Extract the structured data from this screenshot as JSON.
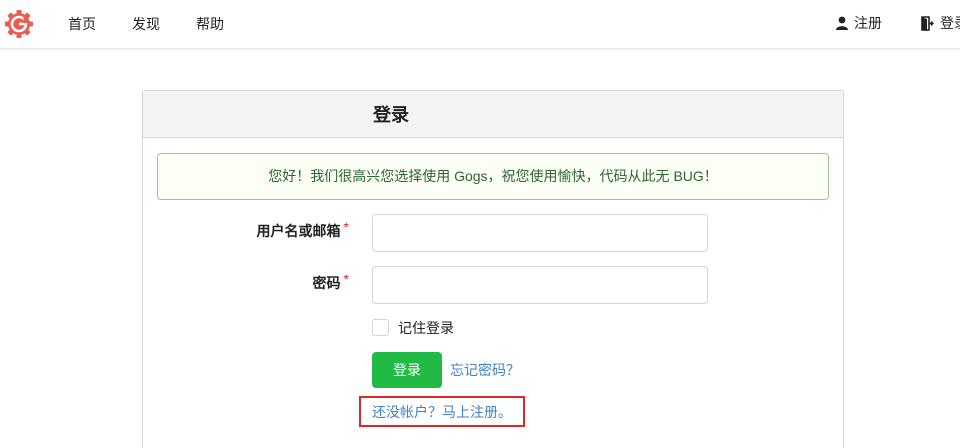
{
  "nav": {
    "items": [
      {
        "label": "首页"
      },
      {
        "label": "发现"
      },
      {
        "label": "帮助"
      }
    ],
    "register_label": "注册",
    "login_label": "登录"
  },
  "login": {
    "title": "登录",
    "welcome_message": "您好！我们很高兴您选择使用 Gogs，祝您使用愉快，代码从此无 BUG！",
    "username_label": "用户名或邮箱",
    "password_label": "密码",
    "required_mark": "*",
    "username_value": "",
    "password_value": "",
    "remember_label": "记住登录",
    "remember_checked": false,
    "submit_label": "登录",
    "forgot_link": "忘记密码？",
    "signup_link": "还没帐户？马上注册。"
  },
  "colors": {
    "brand": "#e95d4e",
    "primary_button": "#21ba45",
    "link": "#4183c4",
    "message_bg": "#fcfff5",
    "message_text": "#2c662d",
    "highlight_box": "#e0262b"
  },
  "icons": {
    "logo": "gogs-logo-icon",
    "register": "user-icon",
    "login": "sign-in-icon"
  }
}
